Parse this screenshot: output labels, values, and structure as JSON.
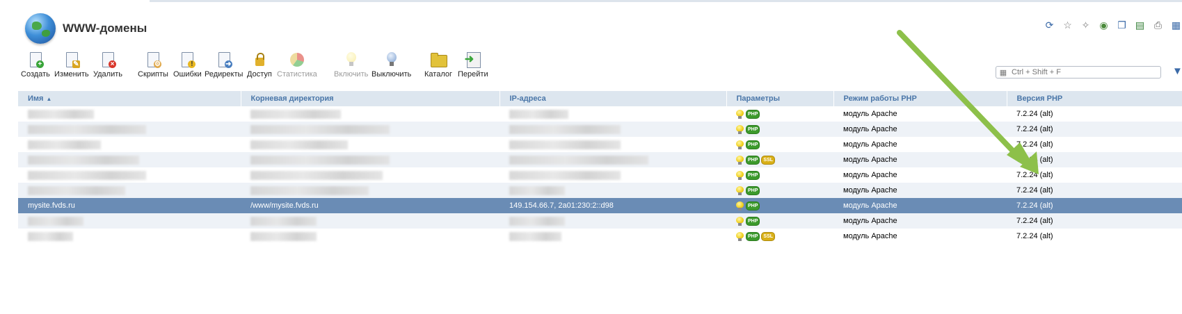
{
  "page": {
    "title": "WWW-домены"
  },
  "toolbar": {
    "create": "Создать",
    "edit": "Изменить",
    "delete": "Удалить",
    "scripts": "Скрипты",
    "errors": "Ошибки",
    "redirects": "Редиректы",
    "access": "Доступ",
    "stats": "Статистика",
    "enable": "Включить",
    "disable": "Выключить",
    "catalog": "Каталог",
    "goto": "Перейти"
  },
  "search": {
    "placeholder": "Ctrl + Shift + F"
  },
  "table": {
    "headers": {
      "name": "Имя",
      "root": "Корневая директория",
      "ip": "IP-адреса",
      "params": "Параметры",
      "php_mode": "Режим работы PHP",
      "php_version": "Версия PHP"
    },
    "rows": [
      {
        "name": "",
        "root": "",
        "ip": "",
        "ssl": false,
        "php_mode": "модуль Apache",
        "php_version": "7.2.24 (alt)"
      },
      {
        "name": "",
        "root": "",
        "ip": "",
        "ssl": false,
        "php_mode": "модуль Apache",
        "php_version": "7.2.24 (alt)"
      },
      {
        "name": "",
        "root": "",
        "ip": "",
        "ssl": false,
        "php_mode": "модуль Apache",
        "php_version": "7.2.24 (alt)"
      },
      {
        "name": "",
        "root": "",
        "ip": "",
        "ssl": true,
        "php_mode": "модуль Apache",
        "php_version": "7.2.24 (alt)"
      },
      {
        "name": "",
        "root": "",
        "ip": "",
        "ssl": false,
        "php_mode": "модуль Apache",
        "php_version": "7.2.24 (alt)"
      },
      {
        "name": "",
        "root": "",
        "ip": "",
        "ssl": false,
        "php_mode": "модуль Apache",
        "php_version": "7.2.24 (alt)"
      },
      {
        "name": "mysite.fvds.ru",
        "root": "/www/mysite.fvds.ru",
        "ip": "149.154.66.7, 2a01:230:2::d98",
        "ssl": false,
        "php_mode": "модуль Apache",
        "php_version": "7.2.24 (alt)",
        "selected": true
      },
      {
        "name": "",
        "root": "",
        "ip": "",
        "ssl": false,
        "php_mode": "модуль Apache",
        "php_version": "7.2.24 (alt)"
      },
      {
        "name": "",
        "root": "",
        "ip": "",
        "ssl": true,
        "php_mode": "модуль Apache",
        "php_version": "7.2.24 (alt)"
      }
    ]
  },
  "badges": {
    "php": "PHP",
    "ssl": "SSL"
  },
  "colors": {
    "header_bg": "#dde6ef",
    "header_text": "#4a76a8",
    "selected_row": "#6a8cb5",
    "arrow": "#8dc04a"
  }
}
